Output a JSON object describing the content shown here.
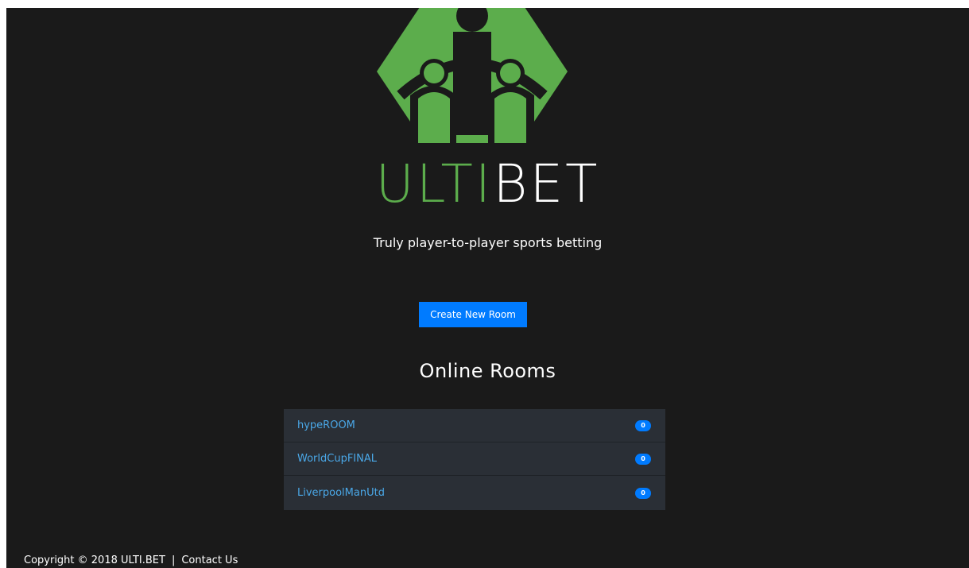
{
  "brand": {
    "part1": "ULTI",
    "part2": "BET",
    "accent_color": "#5cad4c",
    "logo_icon": "players-table-logo"
  },
  "tagline": "Truly player-to-player sports betting",
  "create_button_label": "Create New Room",
  "rooms": {
    "heading": "Online Rooms",
    "items": [
      {
        "name": "hypeROOM",
        "count": "0"
      },
      {
        "name": "WorldCupFINAL",
        "count": "0"
      },
      {
        "name": "LiverpoolManUtd",
        "count": "0"
      }
    ]
  },
  "footer": {
    "copyright": "Copyright © 2018 ULTI.BET",
    "separator": "|",
    "contact": "Contact Us"
  },
  "colors": {
    "background": "#1a1a1a",
    "primary": "#007bff",
    "room_link": "#4aa8e8",
    "list_bg": "#2a2f36"
  }
}
